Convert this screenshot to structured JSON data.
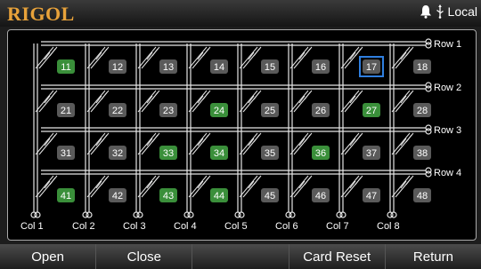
{
  "header": {
    "logo": "RIGOL",
    "status_text": "Local",
    "icons": [
      "bell-icon",
      "usb-icon"
    ]
  },
  "matrix": {
    "rows": [
      "Row 1",
      "Row 2",
      "Row 3",
      "Row 4"
    ],
    "cols": [
      "Col 1",
      "Col 2",
      "Col 3",
      "Col 4",
      "Col 5",
      "Col 6",
      "Col 7",
      "Col 8"
    ],
    "cells": [
      {
        "id": "11",
        "row": 1,
        "col": 1,
        "closed": true
      },
      {
        "id": "12",
        "row": 1,
        "col": 2,
        "closed": false
      },
      {
        "id": "13",
        "row": 1,
        "col": 3,
        "closed": false
      },
      {
        "id": "14",
        "row": 1,
        "col": 4,
        "closed": false
      },
      {
        "id": "15",
        "row": 1,
        "col": 5,
        "closed": false
      },
      {
        "id": "16",
        "row": 1,
        "col": 6,
        "closed": false
      },
      {
        "id": "17",
        "row": 1,
        "col": 7,
        "closed": false,
        "selected": true
      },
      {
        "id": "18",
        "row": 1,
        "col": 8,
        "closed": false
      },
      {
        "id": "21",
        "row": 2,
        "col": 1,
        "closed": false
      },
      {
        "id": "22",
        "row": 2,
        "col": 2,
        "closed": false
      },
      {
        "id": "23",
        "row": 2,
        "col": 3,
        "closed": false
      },
      {
        "id": "24",
        "row": 2,
        "col": 4,
        "closed": true
      },
      {
        "id": "25",
        "row": 2,
        "col": 5,
        "closed": false
      },
      {
        "id": "26",
        "row": 2,
        "col": 6,
        "closed": false
      },
      {
        "id": "27",
        "row": 2,
        "col": 7,
        "closed": true
      },
      {
        "id": "28",
        "row": 2,
        "col": 8,
        "closed": false
      },
      {
        "id": "31",
        "row": 3,
        "col": 1,
        "closed": false
      },
      {
        "id": "32",
        "row": 3,
        "col": 2,
        "closed": false
      },
      {
        "id": "33",
        "row": 3,
        "col": 3,
        "closed": true
      },
      {
        "id": "34",
        "row": 3,
        "col": 4,
        "closed": true
      },
      {
        "id": "35",
        "row": 3,
        "col": 5,
        "closed": false
      },
      {
        "id": "36",
        "row": 3,
        "col": 6,
        "closed": true
      },
      {
        "id": "37",
        "row": 3,
        "col": 7,
        "closed": false
      },
      {
        "id": "38",
        "row": 3,
        "col": 8,
        "closed": false
      },
      {
        "id": "41",
        "row": 4,
        "col": 1,
        "closed": true
      },
      {
        "id": "42",
        "row": 4,
        "col": 2,
        "closed": false
      },
      {
        "id": "43",
        "row": 4,
        "col": 3,
        "closed": true
      },
      {
        "id": "44",
        "row": 4,
        "col": 4,
        "closed": true
      },
      {
        "id": "45",
        "row": 4,
        "col": 5,
        "closed": false
      },
      {
        "id": "46",
        "row": 4,
        "col": 6,
        "closed": false
      },
      {
        "id": "47",
        "row": 4,
        "col": 7,
        "closed": false
      },
      {
        "id": "48",
        "row": 4,
        "col": 8,
        "closed": false
      }
    ]
  },
  "softkeys": [
    "Open",
    "Close",
    "",
    "Card Reset",
    "Return"
  ],
  "colors": {
    "closed": "#3a8f3a",
    "open": "#5a5a5a",
    "selected_border": "#2f7fe0",
    "logo": "#e8a23a",
    "wire": "#e6e6e6"
  }
}
